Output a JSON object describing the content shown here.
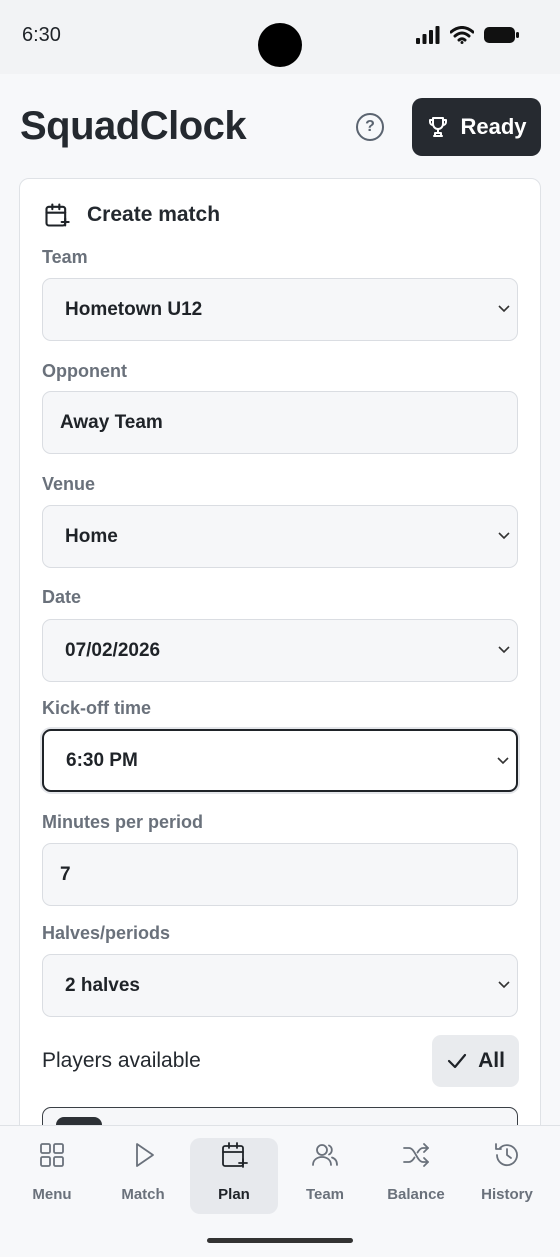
{
  "status_bar": {
    "time": "6:30"
  },
  "header": {
    "title": "SquadClock",
    "help_icon": "question-circle-icon",
    "ready_label": "Ready"
  },
  "form": {
    "title": "Create match",
    "fields": {
      "team": {
        "label": "Team",
        "value": "Hometown U12"
      },
      "opponent": {
        "label": "Opponent",
        "value": "Away Team"
      },
      "venue": {
        "label": "Venue",
        "value": "Home"
      },
      "date": {
        "label": "Date",
        "value": "07/02/2026"
      },
      "kickoff": {
        "label": "Kick-off time",
        "value": "6:30 PM"
      },
      "minutes": {
        "label": "Minutes per period",
        "value": "7"
      },
      "periods": {
        "label": "Halves/periods",
        "value": "2 halves"
      }
    },
    "players": {
      "label": "Players available",
      "all_label": "All"
    }
  },
  "tabs": [
    {
      "label": "Menu",
      "icon": "grid-icon"
    },
    {
      "label": "Match",
      "icon": "play-icon"
    },
    {
      "label": "Plan",
      "icon": "calendar-plus-icon",
      "active": true
    },
    {
      "label": "Team",
      "icon": "users-icon"
    },
    {
      "label": "Balance",
      "icon": "shuffle-icon"
    },
    {
      "label": "History",
      "icon": "history-icon"
    }
  ]
}
